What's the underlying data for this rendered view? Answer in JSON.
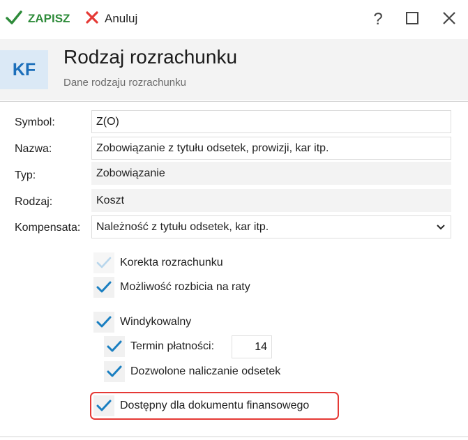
{
  "toolbar": {
    "save_label": "ZAPISZ",
    "cancel_label": "Anuluj",
    "save_icon": "check-icon",
    "cancel_icon": "x-icon",
    "help_icon": "help-icon",
    "maximize_icon": "maximize-icon",
    "close_icon": "close-icon"
  },
  "header": {
    "badge": "KF",
    "title": "Rodzaj rozrachunku",
    "subtitle": "Dane rodzaju rozrachunku"
  },
  "form": {
    "symbol_label": "Symbol:",
    "symbol_value": "Z(O)",
    "nazwa_label": "Nazwa:",
    "nazwa_value": "Zobowiązanie z tytułu odsetek, prowizji, kar itp.",
    "typ_label": "Typ:",
    "typ_value": "Zobowiązanie",
    "rodzaj_label": "Rodzaj:",
    "rodzaj_value": "Koszt",
    "kompensata_label": "Kompensata:",
    "kompensata_value": "Należność z tytułu odsetek, kar itp."
  },
  "checkboxes": {
    "korekta": {
      "label": "Korekta rozrachunku",
      "checked": true,
      "disabled": true
    },
    "raty": {
      "label": "Możliwość rozbicia na raty",
      "checked": true
    },
    "windykowalny": {
      "label": "Windykowalny",
      "checked": true
    },
    "termin": {
      "label": "Termin płatności:",
      "checked": true,
      "value": "14"
    },
    "odsetki": {
      "label": "Dozwolone naliczanie odsetek",
      "checked": true
    },
    "dostepny": {
      "label": "Dostępny dla dokumentu finansowego",
      "checked": true
    }
  },
  "colors": {
    "accent": "#1c6fba",
    "check": "#1a7fc1",
    "save": "#2e8b3a",
    "cancel": "#e53935",
    "highlight": "#e53935"
  }
}
